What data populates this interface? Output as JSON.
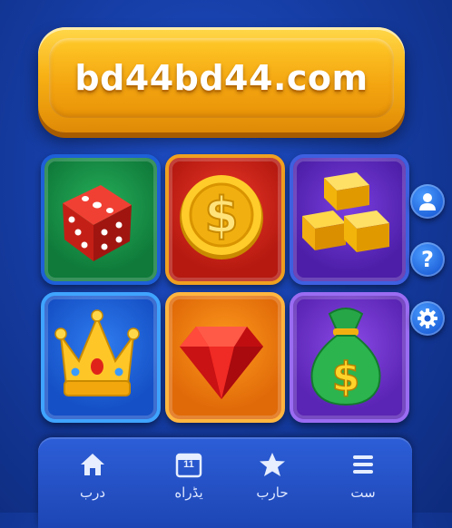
{
  "banner": {
    "text": "bd44bd44.com"
  },
  "tiles": [
    {
      "name": "dice",
      "icon": "dice-icon"
    },
    {
      "name": "coin",
      "icon": "dollar-coin-icon"
    },
    {
      "name": "gold-bars",
      "icon": "gold-bars-icon"
    },
    {
      "name": "crown",
      "icon": "crown-icon"
    },
    {
      "name": "ruby",
      "icon": "ruby-gem-icon"
    },
    {
      "name": "money-bag",
      "icon": "money-bag-icon"
    }
  ],
  "side_buttons": [
    {
      "icon": "user-icon"
    },
    {
      "icon": "help-icon",
      "glyph": "?"
    },
    {
      "icon": "gear-icon"
    }
  ],
  "nav": {
    "items": [
      {
        "icon": "home-icon",
        "label": "درب"
      },
      {
        "icon": "calendar-icon",
        "label": "يڈراه",
        "badge": "11"
      },
      {
        "icon": "star-icon",
        "label": "حارب"
      },
      {
        "icon": "menu-icon",
        "label": "ست"
      }
    ]
  },
  "colors": {
    "background": "#143a9e",
    "banner": "#f8b215",
    "tile_green": "#27b05a",
    "tile_red": "#ef3a2a",
    "tile_purple": "#7b3fe0",
    "tile_blue": "#2f7df0",
    "tile_orange": "#ff9a1e",
    "tile_violet": "#8a4ae6",
    "navbar": "#2d5ed8"
  }
}
